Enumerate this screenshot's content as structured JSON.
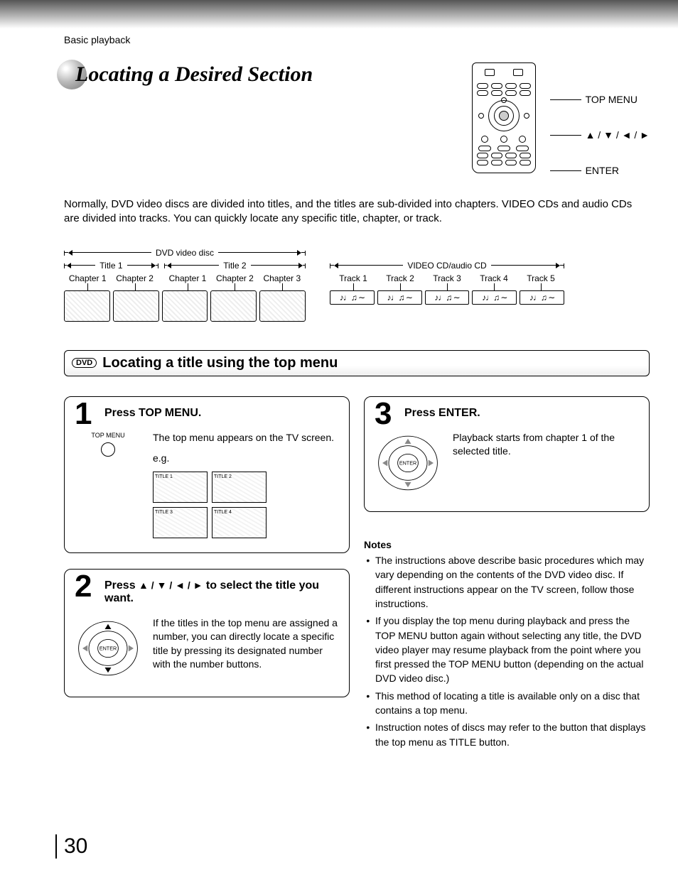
{
  "breadcrumb": "Basic playback",
  "title": "Locating a Desired Section",
  "remote_labels": {
    "top_menu": "TOP MENU",
    "arrows": "▲ / ▼ / ◄ / ►",
    "enter": "ENTER"
  },
  "intro": "Normally, DVD video discs are divided into titles, and the titles are sub-divided into chapters. VIDEO CDs and audio CDs are divided into tracks. You can quickly locate any specific title, chapter, or track.",
  "dvd_diag": {
    "top": "DVD video disc",
    "titles": [
      "Title 1",
      "Title 2"
    ],
    "chapters_t1": [
      "Chapter 1",
      "Chapter 2"
    ],
    "chapters_t2": [
      "Chapter 1",
      "Chapter 2",
      "Chapter 3"
    ]
  },
  "cd_diag": {
    "top": "VIDEO CD/audio CD",
    "tracks": [
      "Track 1",
      "Track 2",
      "Track 3",
      "Track 4",
      "Track 5"
    ],
    "notes_glyph": "♪♩♫ ∼"
  },
  "section_heading": "Locating a title using the top menu",
  "dvd_badge": "DVD",
  "steps": {
    "s1": {
      "num": "1",
      "head": "Press TOP MENU.",
      "icon_label": "TOP MENU",
      "body": "The top menu appears on the TV screen.",
      "eg": "e.g.",
      "tiles": [
        "TITLE 1",
        "TITLE 2",
        "TITLE 3",
        "TITLE 4"
      ]
    },
    "s2": {
      "num": "2",
      "head_pre": "Press ",
      "head_arrows": "▲ / ▼ / ◄ / ►",
      "head_post": " to select the title you want.",
      "dpad_label": "ENTER",
      "body": "If the titles in the top menu are assigned a number, you can directly locate a specific title by pressing its designated number with the number buttons."
    },
    "s3": {
      "num": "3",
      "head": "Press ENTER.",
      "dpad_label": "ENTER",
      "body": "Playback starts from chapter 1 of the selected title."
    }
  },
  "notes_head": "Notes",
  "notes": [
    "The instructions above describe basic procedures which may vary depending on the contents of the DVD video disc. If different instructions appear on the TV screen, follow those instructions.",
    "If you display the top menu during playback and press the TOP MENU button again without selecting any title, the DVD video player may resume playback from the point where you first pressed the TOP MENU button (depending on the actual DVD video disc.)",
    "This method of locating a title is available only on a disc that contains a top menu.",
    "Instruction notes of discs may refer to the button that displays the top menu as TITLE button."
  ],
  "page_number": "30"
}
